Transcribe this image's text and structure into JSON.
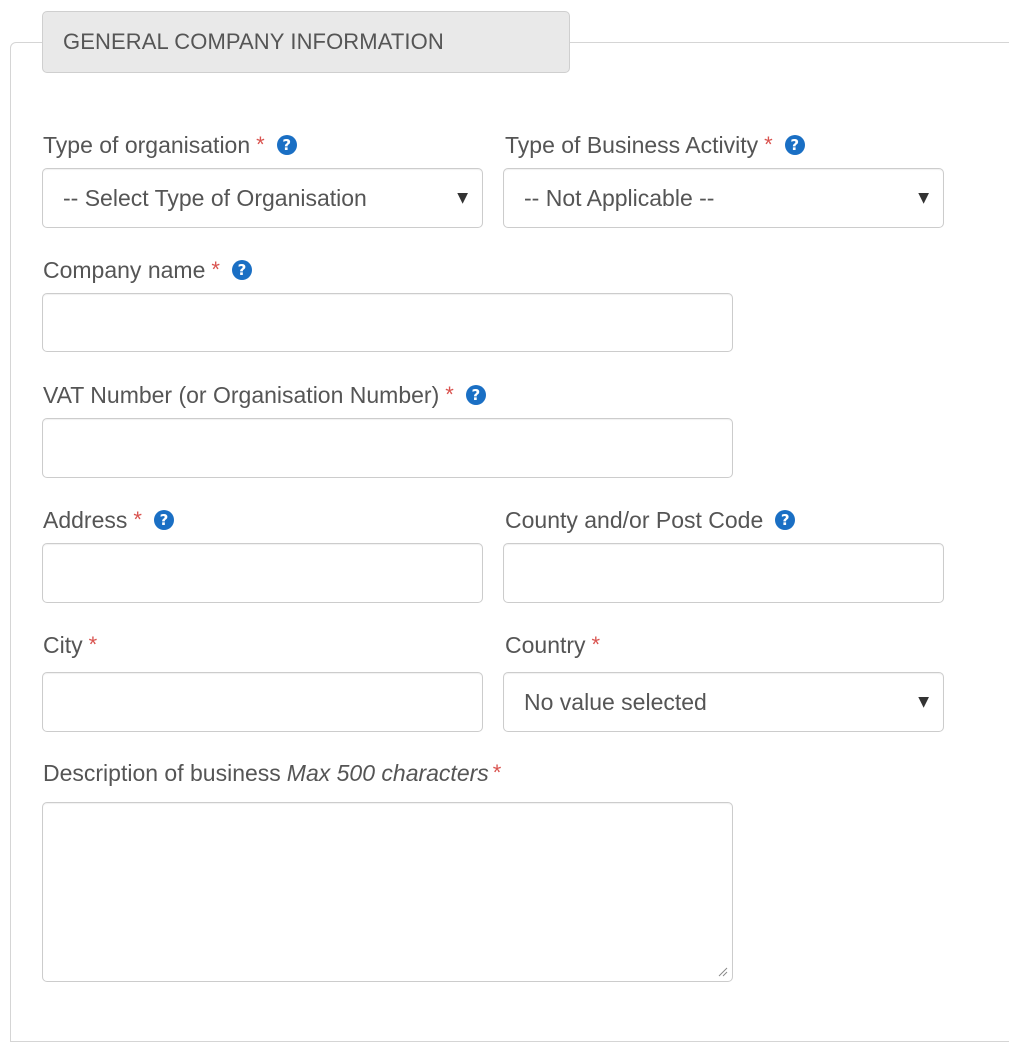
{
  "section": {
    "legend": "GENERAL COMPANY INFORMATION"
  },
  "fields": {
    "org_type": {
      "label": "Type of organisation",
      "required_mark": "*",
      "help_icon": "question-circle-icon",
      "selected": "-- Select Type of Organisation"
    },
    "business_activity": {
      "label": "Type of Business Activity",
      "required_mark": "*",
      "help_icon": "question-circle-icon",
      "selected": "-- Not Applicable --"
    },
    "company_name": {
      "label": "Company name",
      "required_mark": "*",
      "help_icon": "question-circle-icon",
      "value": ""
    },
    "vat_number": {
      "label": "VAT Number (or Organisation Number)",
      "required_mark": "*",
      "help_icon": "question-circle-icon",
      "value": ""
    },
    "address": {
      "label": "Address",
      "required_mark": "*",
      "help_icon": "question-circle-icon",
      "value": ""
    },
    "post_code": {
      "label": "County and/or Post Code",
      "help_icon": "question-circle-icon",
      "value": ""
    },
    "city": {
      "label": "City",
      "required_mark": "*",
      "value": ""
    },
    "country": {
      "label": "Country",
      "required_mark": "*",
      "selected": "No value selected"
    },
    "description": {
      "label": "Description of business",
      "hint": "Max 500 characters",
      "required_mark": "*",
      "value": ""
    }
  },
  "colors": {
    "required": "#d9534f",
    "help_icon": "#1a6fc4",
    "legend_bg": "#e9e9e9",
    "border": "#cccccc",
    "text": "#555555"
  }
}
